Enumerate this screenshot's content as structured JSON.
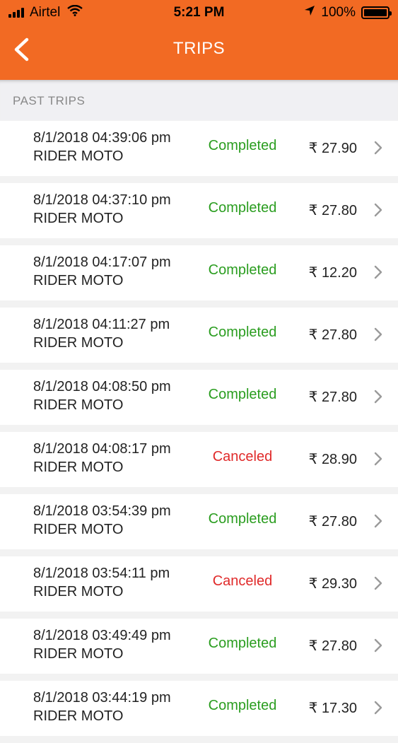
{
  "status_bar": {
    "carrier": "Airtel",
    "time": "5:21 PM",
    "battery": "100%"
  },
  "header": {
    "title": "TRIPS"
  },
  "section": {
    "label": "PAST TRIPS"
  },
  "colors": {
    "brand": "#f26a23",
    "completed": "#2a9d1f",
    "canceled": "#e02a2a"
  },
  "trips": [
    {
      "datetime": "8/1/2018 04:39:06 pm",
      "vehicle": "RIDER MOTO",
      "status": "Completed",
      "fare": "₹ 27.90"
    },
    {
      "datetime": "8/1/2018 04:37:10 pm",
      "vehicle": "RIDER MOTO",
      "status": "Completed",
      "fare": "₹ 27.80"
    },
    {
      "datetime": "8/1/2018 04:17:07 pm",
      "vehicle": "RIDER MOTO",
      "status": "Completed",
      "fare": "₹ 12.20"
    },
    {
      "datetime": "8/1/2018 04:11:27 pm",
      "vehicle": "RIDER MOTO",
      "status": "Completed",
      "fare": "₹ 27.80"
    },
    {
      "datetime": "8/1/2018 04:08:50 pm",
      "vehicle": "RIDER MOTO",
      "status": "Completed",
      "fare": "₹ 27.80"
    },
    {
      "datetime": "8/1/2018 04:08:17 pm",
      "vehicle": "RIDER MOTO",
      "status": "Canceled",
      "fare": "₹ 28.90"
    },
    {
      "datetime": "8/1/2018 03:54:39 pm",
      "vehicle": "RIDER MOTO",
      "status": "Completed",
      "fare": "₹ 27.80"
    },
    {
      "datetime": "8/1/2018 03:54:11 pm",
      "vehicle": "RIDER MOTO",
      "status": "Canceled",
      "fare": "₹ 29.30"
    },
    {
      "datetime": "8/1/2018 03:49:49 pm",
      "vehicle": "RIDER MOTO",
      "status": "Completed",
      "fare": "₹ 27.80"
    },
    {
      "datetime": "8/1/2018 03:44:19 pm",
      "vehicle": "RIDER MOTO",
      "status": "Completed",
      "fare": "₹ 17.30"
    }
  ]
}
